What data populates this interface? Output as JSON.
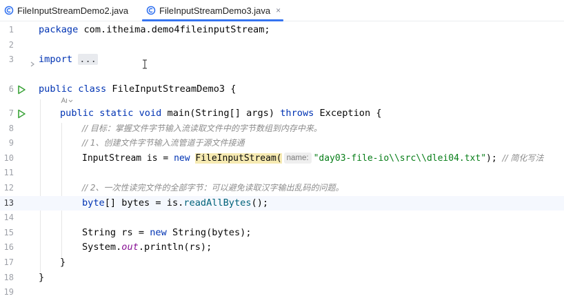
{
  "tabs": [
    {
      "label": "FileInputStreamDemo2.java",
      "active": false
    },
    {
      "label": "FileInputStreamDemo3.java",
      "active": true,
      "close": "×"
    }
  ],
  "editor": {
    "line_numbers": [
      "1",
      "2",
      "3",
      "6",
      "",
      "7",
      "8",
      "9",
      "10",
      "11",
      "12",
      "13",
      "14",
      "15",
      "16",
      "17",
      "18",
      "19"
    ],
    "current_line": "13",
    "lines": {
      "l1": {
        "kw": "package",
        "rest": " com.itheima.demo4fileinputStream;"
      },
      "l3": {
        "kw": "import",
        "dots": "..."
      },
      "l6": {
        "kw": "public class",
        "rest": " FileInputStreamDemo3 {"
      },
      "l7": {
        "kw1": "public static void",
        "mid": " main(String[] args) ",
        "kw2": "throws",
        "rest": " Exception {"
      },
      "l8": {
        "comment": "// 目标：掌握文件字节输入流读取文件中的字节数组到内存中来。"
      },
      "l9": {
        "comment": "// 1、创建文件字节输入流管道于源文件接通"
      },
      "l10": {
        "pre": "InputStream is = ",
        "kw": "new",
        "ctor": "FileInputStream(",
        "hint": "name:",
        "str": "\"day03-file-io\\\\src\\\\dlei04.txt\"",
        "post": "); ",
        "comment": "// 简化写法"
      },
      "l12": {
        "comment": "// 2、一次性读完文件的全部字节：可以避免读取汉字输出乱码的问题。"
      },
      "l13": {
        "kw": "byte",
        "pre": "[] bytes = is.",
        "call": "readAllBytes",
        "post": "();"
      },
      "l15": {
        "pre": "String rs = ",
        "kw": "new",
        "post": " String(bytes);"
      },
      "l16": {
        "pre": "System.",
        "fld": "out",
        "post": ".println(rs);"
      },
      "l17": {
        "brace": "}"
      },
      "l18": {
        "brace": "}"
      }
    }
  },
  "colors": {
    "keyword": "#0033b3",
    "comment": "#8c8c8c",
    "string": "#067d17",
    "accent": "#3574f0",
    "run": "#3ca43a"
  },
  "icons": [
    "java-class-icon",
    "run-icon",
    "fold-arrow-icon",
    "ai-hint-icon",
    "text-cursor-icon"
  ]
}
